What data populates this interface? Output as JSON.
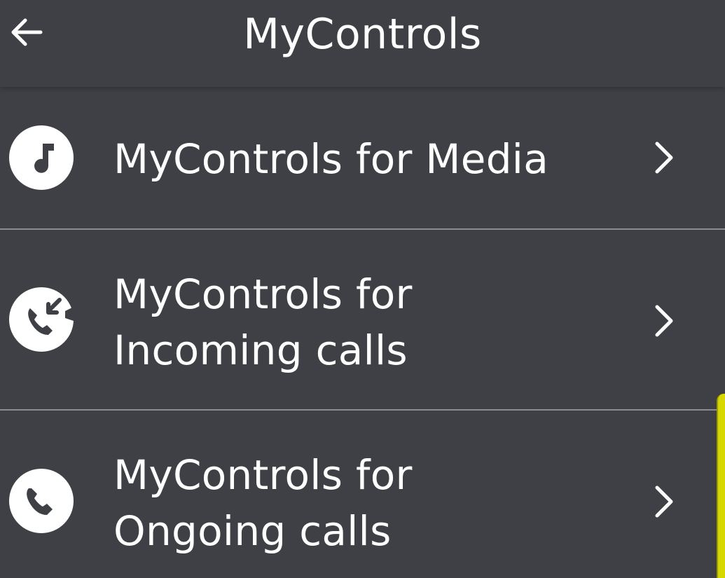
{
  "header": {
    "title": "MyControls",
    "back_icon": "arrow-left-icon"
  },
  "menu": {
    "items": [
      {
        "icon": "music-note-icon",
        "label_line1": "MyControls for Media",
        "label_line2": "",
        "chevron_icon": "chevron-right-icon"
      },
      {
        "icon": "incoming-call-icon",
        "label_line1": "MyControls for",
        "label_line2": "Incoming calls",
        "chevron_icon": "chevron-right-icon"
      },
      {
        "icon": "phone-icon",
        "label_line1": "MyControls for",
        "label_line2": "Ongoing calls",
        "chevron_icon": "chevron-right-icon"
      }
    ]
  },
  "colors": {
    "background": "#3f4045",
    "text": "#ffffff",
    "divider": "#8c8d91",
    "edge_accent": "#d8d800"
  }
}
